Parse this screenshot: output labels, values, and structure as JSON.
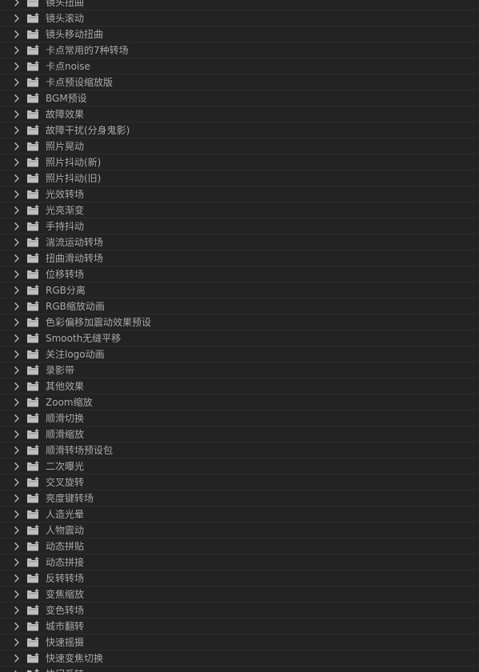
{
  "panel": {
    "title": "",
    "colors": {
      "background": "#232323",
      "row_divider": "#2b2b2b",
      "text": "#a9a9a9",
      "icon": "#bfbfbf"
    },
    "row_icons": {
      "expand": "chevron-right-icon",
      "folder": "preset-folder-icon"
    },
    "items": [
      {
        "label": "镜头扭曲"
      },
      {
        "label": "镜头滚动"
      },
      {
        "label": "镜头移动扭曲"
      },
      {
        "label": "卡点常用的7种转场"
      },
      {
        "label": "卡点noise"
      },
      {
        "label": "卡点预设缩放版"
      },
      {
        "label": "BGM预设"
      },
      {
        "label": "故障效果"
      },
      {
        "label": "故障干扰(分身鬼影)"
      },
      {
        "label": "照片晃动"
      },
      {
        "label": "照片抖动(新)"
      },
      {
        "label": "照片抖动(旧)"
      },
      {
        "label": "光效转场"
      },
      {
        "label": "光亮渐变"
      },
      {
        "label": "手持抖动"
      },
      {
        "label": "湍流运动转场"
      },
      {
        "label": "扭曲滑动转场"
      },
      {
        "label": "位移转场"
      },
      {
        "label": "RGB分离"
      },
      {
        "label": "RGB缩放动画"
      },
      {
        "label": "色彩偏移加震动效果预设"
      },
      {
        "label": "Smooth无缝平移"
      },
      {
        "label": "关注logo动画"
      },
      {
        "label": "录影带"
      },
      {
        "label": "其他效果"
      },
      {
        "label": "Zoom缩放"
      },
      {
        "label": "顺滑切换"
      },
      {
        "label": "顺滑缩放"
      },
      {
        "label": "顺滑转场预设包"
      },
      {
        "label": "二次曝光"
      },
      {
        "label": "交叉旋转"
      },
      {
        "label": "亮度键转场"
      },
      {
        "label": "人造光晕"
      },
      {
        "label": "人物震动"
      },
      {
        "label": "动态拼贴"
      },
      {
        "label": "动态拼接"
      },
      {
        "label": "反转转场"
      },
      {
        "label": "变焦缩放"
      },
      {
        "label": "变色转场"
      },
      {
        "label": "城市翻转"
      },
      {
        "label": "快速摇摄"
      },
      {
        "label": "快速变焦切换"
      },
      {
        "label": "快门系转"
      }
    ]
  }
}
